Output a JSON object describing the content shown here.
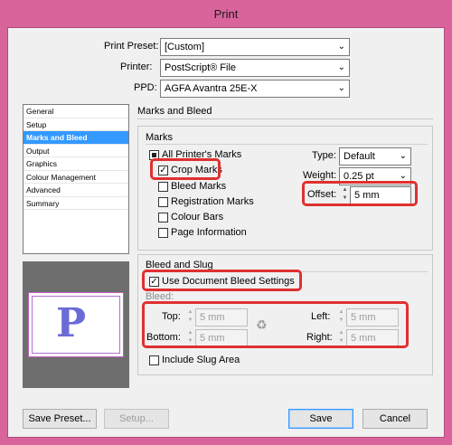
{
  "window": {
    "title": "Print"
  },
  "header": {
    "print_preset_label": "Print Preset:",
    "print_preset_value": "[Custom]",
    "printer_label": "Printer:",
    "printer_value": "PostScript® File",
    "ppd_label": "PPD:",
    "ppd_value": "AGFA Avantra 25E-X"
  },
  "sidebar": {
    "items": [
      {
        "label": "General"
      },
      {
        "label": "Setup"
      },
      {
        "label": "Marks and Bleed"
      },
      {
        "label": "Output"
      },
      {
        "label": "Graphics"
      },
      {
        "label": "Colour Management"
      },
      {
        "label": "Advanced"
      },
      {
        "label": "Summary"
      }
    ],
    "selected_index": 2
  },
  "section_title": "Marks and Bleed",
  "marks": {
    "title": "Marks",
    "all_printers_marks": "All Printer's Marks",
    "crop_marks": "Crop Marks",
    "bleed_marks": "Bleed Marks",
    "registration_marks": "Registration Marks",
    "colour_bars": "Colour Bars",
    "page_information": "Page Information",
    "type_label": "Type:",
    "type_value": "Default",
    "weight_label": "Weight:",
    "weight_value": "0.25 pt",
    "offset_label": "Offset:",
    "offset_value": "5 mm"
  },
  "bleed": {
    "title": "Bleed and Slug",
    "use_doc_bleed": "Use Document Bleed Settings",
    "bleed_label": "Bleed:",
    "top_label": "Top:",
    "top_value": "5 mm",
    "bottom_label": "Bottom:",
    "bottom_value": "5 mm",
    "left_label": "Left:",
    "left_value": "5 mm",
    "right_label": "Right:",
    "right_value": "5 mm",
    "include_slug": "Include Slug Area"
  },
  "preview": {
    "letter": "P"
  },
  "buttons": {
    "save_preset": "Save Preset...",
    "setup": "Setup...",
    "save": "Save",
    "cancel": "Cancel"
  },
  "colors": {
    "titlebar": "#d9649c",
    "highlight": "#e03030",
    "selection": "#3399ff"
  }
}
